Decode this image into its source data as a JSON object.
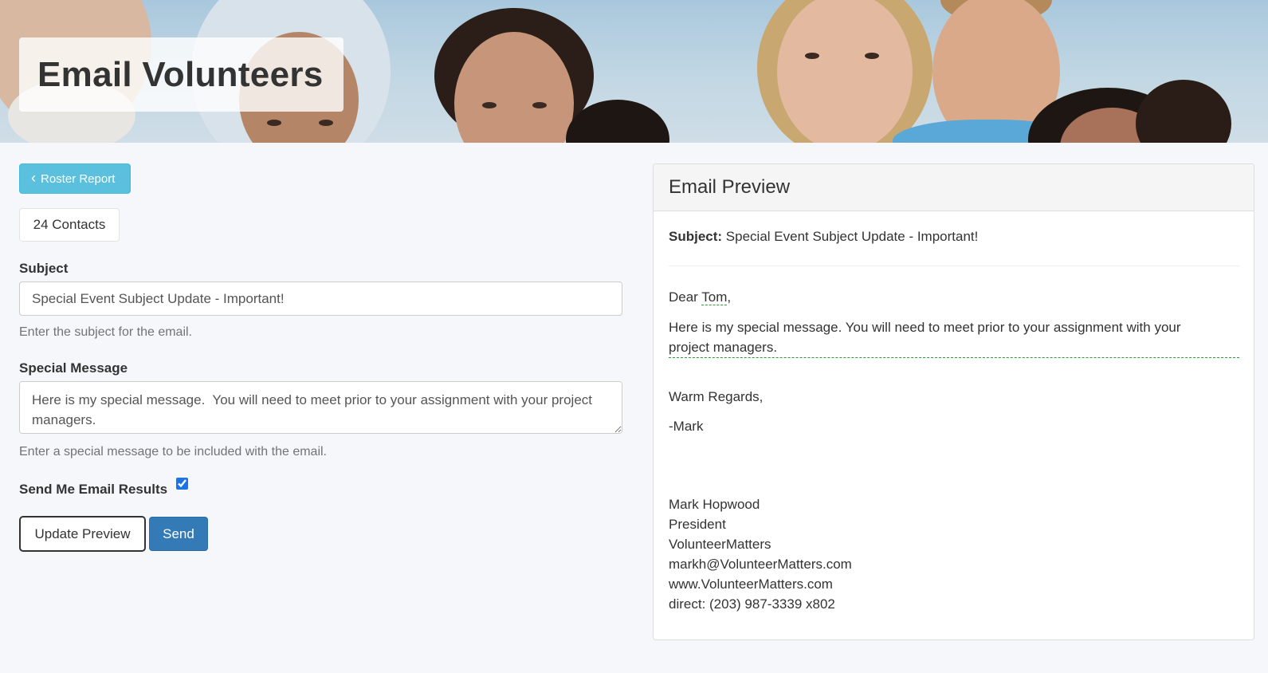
{
  "header": {
    "title": "Email Volunteers"
  },
  "left": {
    "back_button_label": "Roster Report",
    "contacts_count": "24 Contacts",
    "subject_label": "Subject",
    "subject_value": "Special Event Subject Update - Important!",
    "subject_help": "Enter the subject for the email.",
    "message_label": "Special Message",
    "message_value": "Here is my special message.  You will need to meet prior to your assignment with your project managers.",
    "message_help": "Enter a special message to be included with the email.",
    "send_results_label": "Send Me Email Results",
    "send_results_checked": true,
    "update_preview_label": "Update Preview",
    "send_label": "Send"
  },
  "preview": {
    "title": "Email Preview",
    "subject_prefix": "Subject:",
    "subject_text": "Special Event Subject Update - Important!",
    "greeting_prefix": "Dear",
    "greeting_name": "Tom",
    "greeting_suffix": ",",
    "message": "Here is my special message. You will need to meet prior to your assignment with your project managers.",
    "closing": "Warm Regards,",
    "sender_short": "-Mark",
    "signature": [
      "Mark Hopwood",
      "President",
      "VolunteerMatters",
      "markh@VolunteerMatters.com",
      "www.VolunteerMatters.com",
      "direct: (203) 987-3339 x802"
    ]
  },
  "colors": {
    "info_button": "#5bc0de",
    "primary_button": "#337ab7",
    "dashed_underline": "#2a9a3a"
  }
}
